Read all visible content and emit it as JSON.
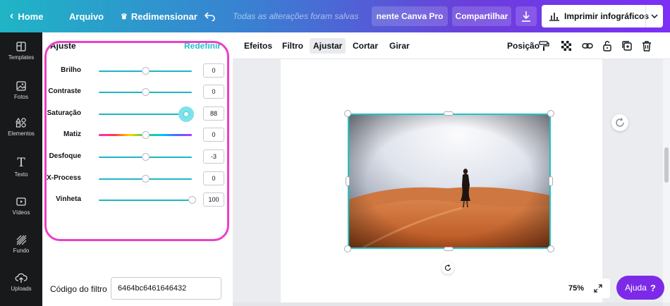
{
  "topbar": {
    "home_label": "Home",
    "file_label": "Arquivo",
    "resize_label": "Redimensionar",
    "saved_status": "Todas as alterações foram salvas",
    "try_pro_label": "nente Canva Pro",
    "share_label": "Compartilhar",
    "print_label": "Imprimir infográficos",
    "gradient_colors": [
      "#1fb5c6",
      "#3a7fd2",
      "#6a3fdb",
      "#7b2ff7"
    ]
  },
  "leftnav": {
    "items": [
      {
        "label": "Templates",
        "icon": "templates-icon"
      },
      {
        "label": "Fotos",
        "icon": "photos-icon"
      },
      {
        "label": "Elementos",
        "icon": "elements-icon"
      },
      {
        "label": "Texto",
        "icon": "text-icon"
      },
      {
        "label": "Vídeos",
        "icon": "videos-icon"
      },
      {
        "label": "Fundo",
        "icon": "background-icon"
      },
      {
        "label": "Uploads",
        "icon": "uploads-icon"
      }
    ]
  },
  "adjust_panel": {
    "title": "Ajuste",
    "reset_label": "Redefinir",
    "rows": [
      {
        "label": "Brilho",
        "value": "0",
        "level": 0.5
      },
      {
        "label": "Contraste",
        "value": "0",
        "level": 0.5
      },
      {
        "label": "Saturação",
        "value": "88",
        "level": 0.94
      },
      {
        "label": "Matiz",
        "value": "0",
        "level": 0.5
      },
      {
        "label": "Desfoque",
        "value": "-3",
        "level": 0.5
      },
      {
        "label": "X-Process",
        "value": "0",
        "level": 0.5
      },
      {
        "label": "Vinheta",
        "value": "100",
        "level": 1.0
      }
    ],
    "filter_code_label": "Código do filtro",
    "filter_code_value": "6464bc6461646432",
    "accent_color": "#23c1c7",
    "highlight_color": "#ec3fc8"
  },
  "toolbar": {
    "tabs": [
      "Efeitos",
      "Filtro",
      "Ajustar",
      "Cortar",
      "Girar"
    ],
    "active_tab": "Ajustar",
    "position_label": "Posição"
  },
  "canvas": {
    "zoom": "75%",
    "help_label": "Ajuda",
    "help_symbol": "?"
  }
}
